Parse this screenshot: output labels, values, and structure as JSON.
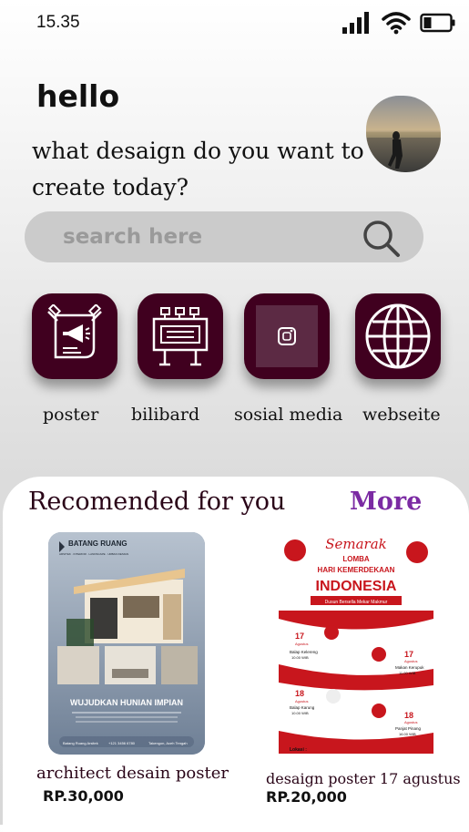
{
  "status": {
    "time": "15.35",
    "icons": [
      "signal-icon",
      "wifi-icon",
      "battery-icon"
    ]
  },
  "greeting": {
    "hello": "hello",
    "question": "what desaign do you want to create today?"
  },
  "search": {
    "placeholder": "search here",
    "icon": "search-icon"
  },
  "categories": [
    {
      "label": "poster",
      "icon": "megaphone-poster-icon"
    },
    {
      "label": "bilibard",
      "icon": "billboard-icon"
    },
    {
      "label": "sosial media",
      "icon": "social-media-icon"
    },
    {
      "label": "webseite",
      "icon": "globe-icon"
    }
  ],
  "recommended": {
    "title": "Recomended for you",
    "more": "More",
    "items": [
      {
        "caption": "architect desain poster",
        "price": "RP.30,000",
        "poster": {
          "brand": "BATANG RUANG",
          "tagline": "ARSITEK · INTERIOR · LANDSCAPE · URBAN DESIGN",
          "headline": "WUJUDKAN HUNIAN IMPIAN",
          "footer": [
            "Batang Ruang Arsitek",
            "+121 3456 6780",
            "Takengon, Aceh Tengah"
          ]
        }
      },
      {
        "caption": "desaign poster 17 agustus",
        "price": "RP.20,000",
        "poster": {
          "script": "Semarak",
          "line1": "LOMBA",
          "line2": "HARI KEMERDEKAAN",
          "line3": "INDONESIA",
          "org": "Dusun Bersella Mekar Makmur",
          "events": [
            {
              "day": "17",
              "month": "Agustus",
              "name": "Balap Kelereng",
              "time": "10.00 WIB"
            },
            {
              "day": "17",
              "month": "Agustus",
              "name": "Makan Kerupuk",
              "time": "11.00 WIB"
            },
            {
              "day": "18",
              "month": "Agustus",
              "name": "Balap Karung",
              "time": "10.00 WIB"
            },
            {
              "day": "18",
              "month": "Agustus",
              "name": "Panjat Pinang",
              "time": "16.00 WIB"
            }
          ],
          "location": "Lokasi :"
        }
      }
    ]
  },
  "colors": {
    "accent": "#40001f",
    "more": "#7b2aa3",
    "flagRed": "#c8161d"
  }
}
